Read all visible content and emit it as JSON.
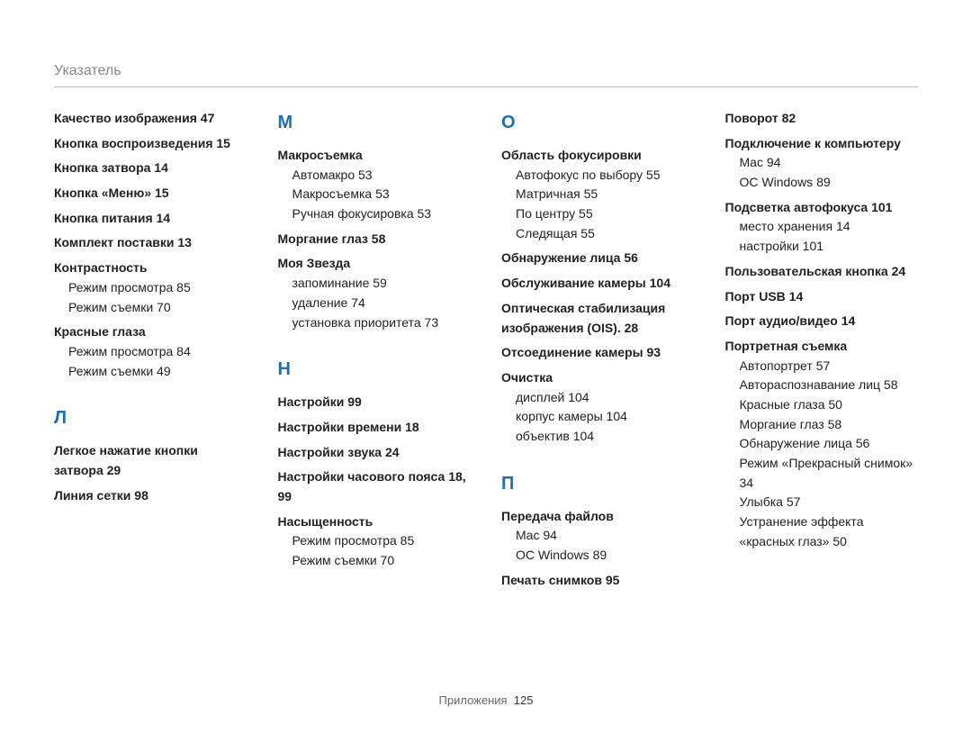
{
  "header": "Указатель",
  "footer_label": "Приложения",
  "footer_page": "125",
  "columns": [
    {
      "blocks": [
        {
          "type": "entries",
          "items": [
            {
              "title": "Качество изображения",
              "pages": "47"
            },
            {
              "title": "Кнопка воспроизведения",
              "pages": "15"
            },
            {
              "title": "Кнопка затвора",
              "pages": "14"
            },
            {
              "title": "Кнопка «Меню»",
              "pages": "15"
            },
            {
              "title": "Кнопка питания",
              "pages": "14"
            },
            {
              "title": "Комплект поставки",
              "pages": "13"
            },
            {
              "title": "Контрастность",
              "subs": [
                {
                  "label": "Режим просмотра",
                  "pages": "85"
                },
                {
                  "label": "Режим съемки",
                  "pages": "70"
                }
              ]
            },
            {
              "title": "Красные глаза",
              "subs": [
                {
                  "label": "Режим просмотра",
                  "pages": "84"
                },
                {
                  "label": "Режим съемки",
                  "pages": "49"
                }
              ]
            }
          ]
        },
        {
          "type": "letter",
          "label": "Л"
        },
        {
          "type": "entries",
          "items": [
            {
              "title": "Легкое нажатие кнопки затвора",
              "pages": "29"
            },
            {
              "title": "Линия сетки",
              "pages": "98"
            }
          ]
        }
      ]
    },
    {
      "blocks": [
        {
          "type": "letter",
          "label": "М",
          "first": true
        },
        {
          "type": "entries",
          "items": [
            {
              "title": "Макросъемка",
              "subs": [
                {
                  "label": "Автомакро",
                  "pages": "53"
                },
                {
                  "label": "Макросъемка",
                  "pages": "53"
                },
                {
                  "label": "Ручная фокусировка",
                  "pages": "53"
                }
              ]
            },
            {
              "title": "Моргание глаз",
              "pages": "58"
            },
            {
              "title": "Моя Звезда",
              "subs": [
                {
                  "label": "запоминание",
                  "pages": "59"
                },
                {
                  "label": "удаление",
                  "pages": "74"
                },
                {
                  "label": "установка приоритета",
                  "pages": "73"
                }
              ]
            }
          ]
        },
        {
          "type": "letter",
          "label": "Н"
        },
        {
          "type": "entries",
          "items": [
            {
              "title": "Настройки",
              "pages": "99"
            },
            {
              "title": "Настройки времени",
              "pages": "18"
            },
            {
              "title": "Настройки звука",
              "pages": "24"
            },
            {
              "title": "Настройки часового пояса",
              "pages": "18, 99"
            },
            {
              "title": "Насыщенность",
              "subs": [
                {
                  "label": "Режим просмотра",
                  "pages": "85"
                },
                {
                  "label": "Режим съемки",
                  "pages": "70"
                }
              ]
            }
          ]
        }
      ]
    },
    {
      "blocks": [
        {
          "type": "letter",
          "label": "О",
          "first": true
        },
        {
          "type": "entries",
          "items": [
            {
              "title": "Область фокусировки",
              "subs": [
                {
                  "label": "Автофокус по выбору",
                  "pages": "55"
                },
                {
                  "label": "Матричная",
                  "pages": "55"
                },
                {
                  "label": "По центру",
                  "pages": "55"
                },
                {
                  "label": "Следящая",
                  "pages": "55"
                }
              ]
            },
            {
              "title": "Обнаружение лица",
              "pages": "56"
            },
            {
              "title": "Обслуживание камеры",
              "pages": "104"
            },
            {
              "title": "Оптическая стабилизация изображения (OIS).",
              "pages": "28"
            },
            {
              "title": "Отсоединение камеры",
              "pages": "93"
            },
            {
              "title": "Очистка",
              "subs": [
                {
                  "label": "дисплей",
                  "pages": "104"
                },
                {
                  "label": "корпус камеры",
                  "pages": "104"
                },
                {
                  "label": "объектив",
                  "pages": "104"
                }
              ]
            }
          ]
        },
        {
          "type": "letter",
          "label": "П"
        },
        {
          "type": "entries",
          "items": [
            {
              "title": "Передача файлов",
              "subs": [
                {
                  "label": "Mac",
                  "pages": "94"
                },
                {
                  "label": "ОС Windows",
                  "pages": "89"
                }
              ]
            },
            {
              "title": "Печать снимков",
              "pages": "95"
            }
          ]
        }
      ]
    },
    {
      "blocks": [
        {
          "type": "entries",
          "items": [
            {
              "title": "Поворот",
              "pages": "82"
            },
            {
              "title": "Подключение к компьютеру",
              "subs": [
                {
                  "label": "Mac",
                  "pages": "94"
                },
                {
                  "label": "ОС Windows",
                  "pages": "89"
                }
              ]
            },
            {
              "title": "Подсветка автофокуса",
              "pages": "101",
              "subs": [
                {
                  "label": "место хранения",
                  "pages": "14"
                },
                {
                  "label": "настройки",
                  "pages": "101"
                }
              ]
            },
            {
              "title": "Пользовательская кнопка",
              "pages": "24"
            },
            {
              "title": "Порт USB",
              "pages": "14"
            },
            {
              "title": "Порт аудио/видео",
              "pages": "14"
            },
            {
              "title": "Портретная съемка",
              "subs": [
                {
                  "label": "Автопортрет",
                  "pages": "57"
                },
                {
                  "label": "Автораспознавание лиц",
                  "pages": "58"
                },
                {
                  "label": "Красные глаза",
                  "pages": "50"
                },
                {
                  "label": "Моргание глаз",
                  "pages": "58"
                },
                {
                  "label": "Обнаружение лица",
                  "pages": "56"
                },
                {
                  "label": "Режим «Прекрасный снимок»",
                  "pages": "34"
                },
                {
                  "label": "Улыбка",
                  "pages": "57"
                },
                {
                  "label": "Устранение эффекта «красных глаз»",
                  "pages": "50"
                }
              ]
            }
          ]
        }
      ]
    }
  ]
}
